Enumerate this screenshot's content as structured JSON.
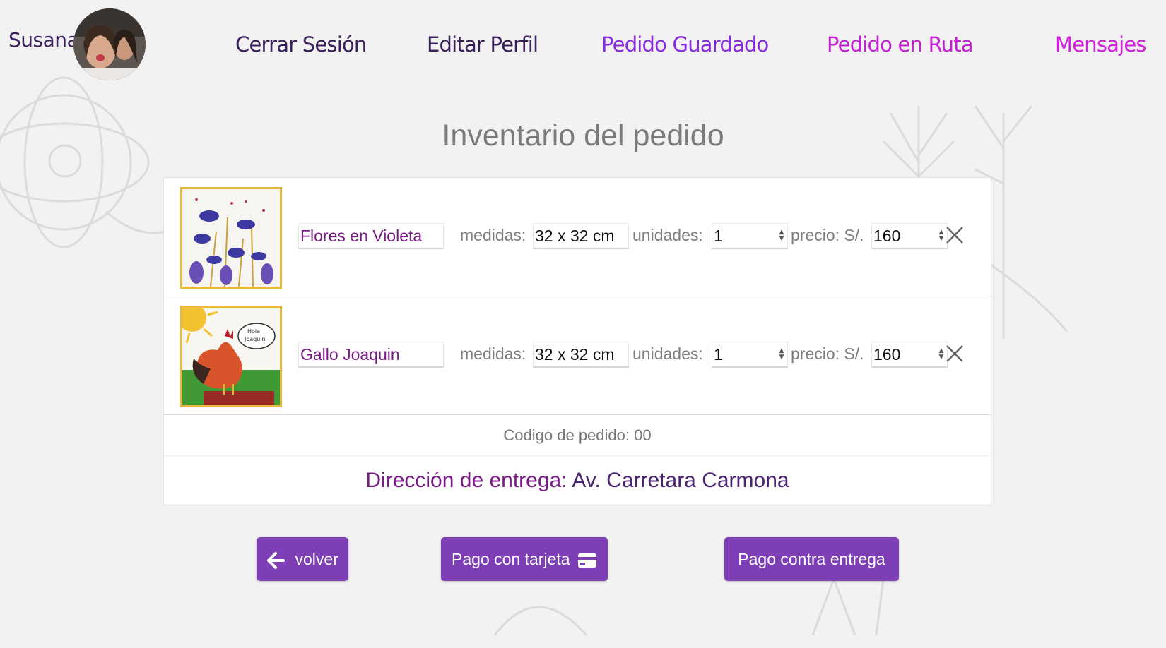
{
  "user": {
    "name": "Susana"
  },
  "nav": [
    {
      "label": "Cerrar Sesión",
      "color": "#3b1f5c"
    },
    {
      "label": "Editar Perfil",
      "color": "#3b1f5c"
    },
    {
      "label": "Pedido Guardado",
      "color": "#8a2be2"
    },
    {
      "label": "Pedido en Ruta",
      "color": "#c71fd8"
    },
    {
      "label": "Mensajes",
      "color": "#d21fe0"
    }
  ],
  "page": {
    "title": "Inventario del pedido"
  },
  "items": [
    {
      "name": "Flores en Violeta",
      "medidas_label": "medidas:",
      "medidas": "32 x 32 cm",
      "unidades_label": "unidades:",
      "unidades": "1",
      "precio_label": "precio: S/.",
      "precio": "160",
      "image": "violet-flowers-painting"
    },
    {
      "name": "Gallo Joaquin",
      "medidas_label": "medidas:",
      "medidas": "32 x 32 cm",
      "unidades_label": "unidades:",
      "unidades": "1",
      "precio_label": "precio: S/.",
      "precio": "160",
      "image": "rooster-painting",
      "speech": "Hola Joaquin"
    }
  ],
  "order": {
    "code_text": "Codigo de pedido: 00",
    "address_label": "Dirección de entrega:",
    "address_value": "Av. Carretara Carmona",
    "address_label_color": "#7a1a86",
    "address_value_color": "#4a2470"
  },
  "buttons": {
    "back": {
      "label": "volver",
      "icon": "arrow-left-icon"
    },
    "card": {
      "label": "Pago con tarjeta",
      "icon": "credit-card-icon"
    },
    "cod": {
      "label": "Pago contra entrega"
    }
  },
  "colors": {
    "accent": "#7e3fb6",
    "background": "#f3f2f3",
    "thumb_frame": "#e8b93a"
  }
}
